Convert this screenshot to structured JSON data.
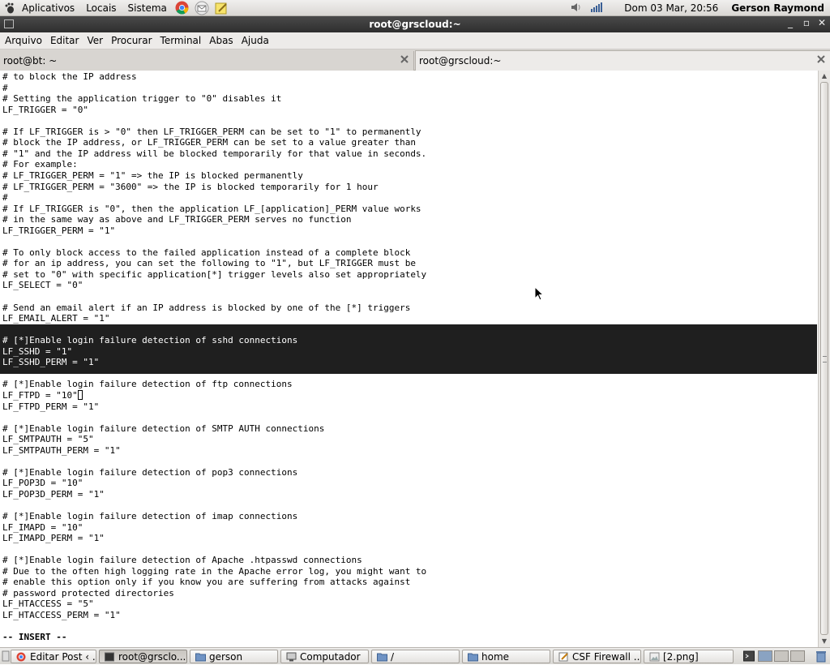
{
  "top_panel": {
    "menus": [
      "Aplicativos",
      "Locais",
      "Sistema"
    ],
    "launchers": [
      "chrome-icon",
      "mail-icon",
      "notes-icon"
    ],
    "clock": "Dom 03 Mar, 20:56",
    "user": "Gerson Raymond"
  },
  "window": {
    "title": "root@grscloud:~"
  },
  "menubar": [
    "Arquivo",
    "Editar",
    "Ver",
    "Procurar",
    "Terminal",
    "Abas",
    "Ajuda"
  ],
  "tabs": [
    {
      "label": "root@bt: ~",
      "active": false
    },
    {
      "label": "root@grscloud:~",
      "active": true
    }
  ],
  "terminal": {
    "lines": [
      "# to block the IP address",
      "#",
      "# Setting the application trigger to \"0\" disables it",
      "LF_TRIGGER = \"0\"",
      "",
      "# If LF_TRIGGER is > \"0\" then LF_TRIGGER_PERM can be set to \"1\" to permanently",
      "# block the IP address, or LF_TRIGGER_PERM can be set to a value greater than",
      "# \"1\" and the IP address will be blocked temporarily for that value in seconds.",
      "# For example:",
      "# LF_TRIGGER_PERM = \"1\" => the IP is blocked permanently",
      "# LF_TRIGGER_PERM = \"3600\" => the IP is blocked temporarily for 1 hour",
      "#",
      "# If LF_TRIGGER is \"0\", then the application LF_[application]_PERM value works",
      "# in the same way as above and LF_TRIGGER_PERM serves no function",
      "LF_TRIGGER_PERM = \"1\"",
      "",
      "# To only block access to the failed application instead of a complete block",
      "# for an ip address, you can set the following to \"1\", but LF_TRIGGER must be",
      "# set to \"0\" with specific application[*] trigger levels also set appropriately",
      "LF_SELECT = \"0\"",
      "",
      "# Send an email alert if an IP address is blocked by one of the [*] triggers",
      "LF_EMAIL_ALERT = \"1\"",
      "",
      "# [*]Enable login failure detection of sshd connections",
      "LF_SSHD = \"1\"",
      "LF_SSHD_PERM = \"1\"",
      "",
      "# [*]Enable login failure detection of ftp connections",
      "LF_FTPD = \"10\"",
      "LF_FTPD_PERM = \"1\"",
      "",
      "# [*]Enable login failure detection of SMTP AUTH connections",
      "LF_SMTPAUTH = \"5\"",
      "LF_SMTPAUTH_PERM = \"1\"",
      "",
      "# [*]Enable login failure detection of pop3 connections",
      "LF_POP3D = \"10\"",
      "LF_POP3D_PERM = \"1\"",
      "",
      "# [*]Enable login failure detection of imap connections",
      "LF_IMAPD = \"10\"",
      "LF_IMAPD_PERM = \"1\"",
      "",
      "# [*]Enable login failure detection of Apache .htpasswd connections",
      "# Due to the often high logging rate in the Apache error log, you might want to",
      "# enable this option only if you know you are suffering from attacks against",
      "# password protected directories",
      "LF_HTACCESS = \"5\"",
      "LF_HTACCESS_PERM = \"1\"",
      "",
      "-- INSERT --"
    ],
    "selected_lines": [
      23,
      24,
      25,
      26
    ],
    "cursor_line": 29,
    "status_line": 51
  },
  "taskbar": [
    {
      "label": "Editar Post ‹ ...",
      "icon": "chrome-icon",
      "active": false
    },
    {
      "label": "root@grsclo...",
      "icon": "terminal-icon",
      "active": true
    },
    {
      "label": "gerson",
      "icon": "folder-icon",
      "active": false
    },
    {
      "label": "Computador",
      "icon": "computer-icon",
      "active": false
    },
    {
      "label": "/",
      "icon": "folder-icon",
      "active": false
    },
    {
      "label": "home",
      "icon": "folder-icon",
      "active": false
    },
    {
      "label": "CSF Firewall ...",
      "icon": "editor-icon",
      "active": false
    },
    {
      "label": "[2.png]",
      "icon": "image-icon",
      "active": false
    }
  ],
  "colors": {
    "selection_bg": "#1f1f1f",
    "titlebar_bg": "#3b3b3b",
    "panel_bg": "#e3e1de"
  }
}
